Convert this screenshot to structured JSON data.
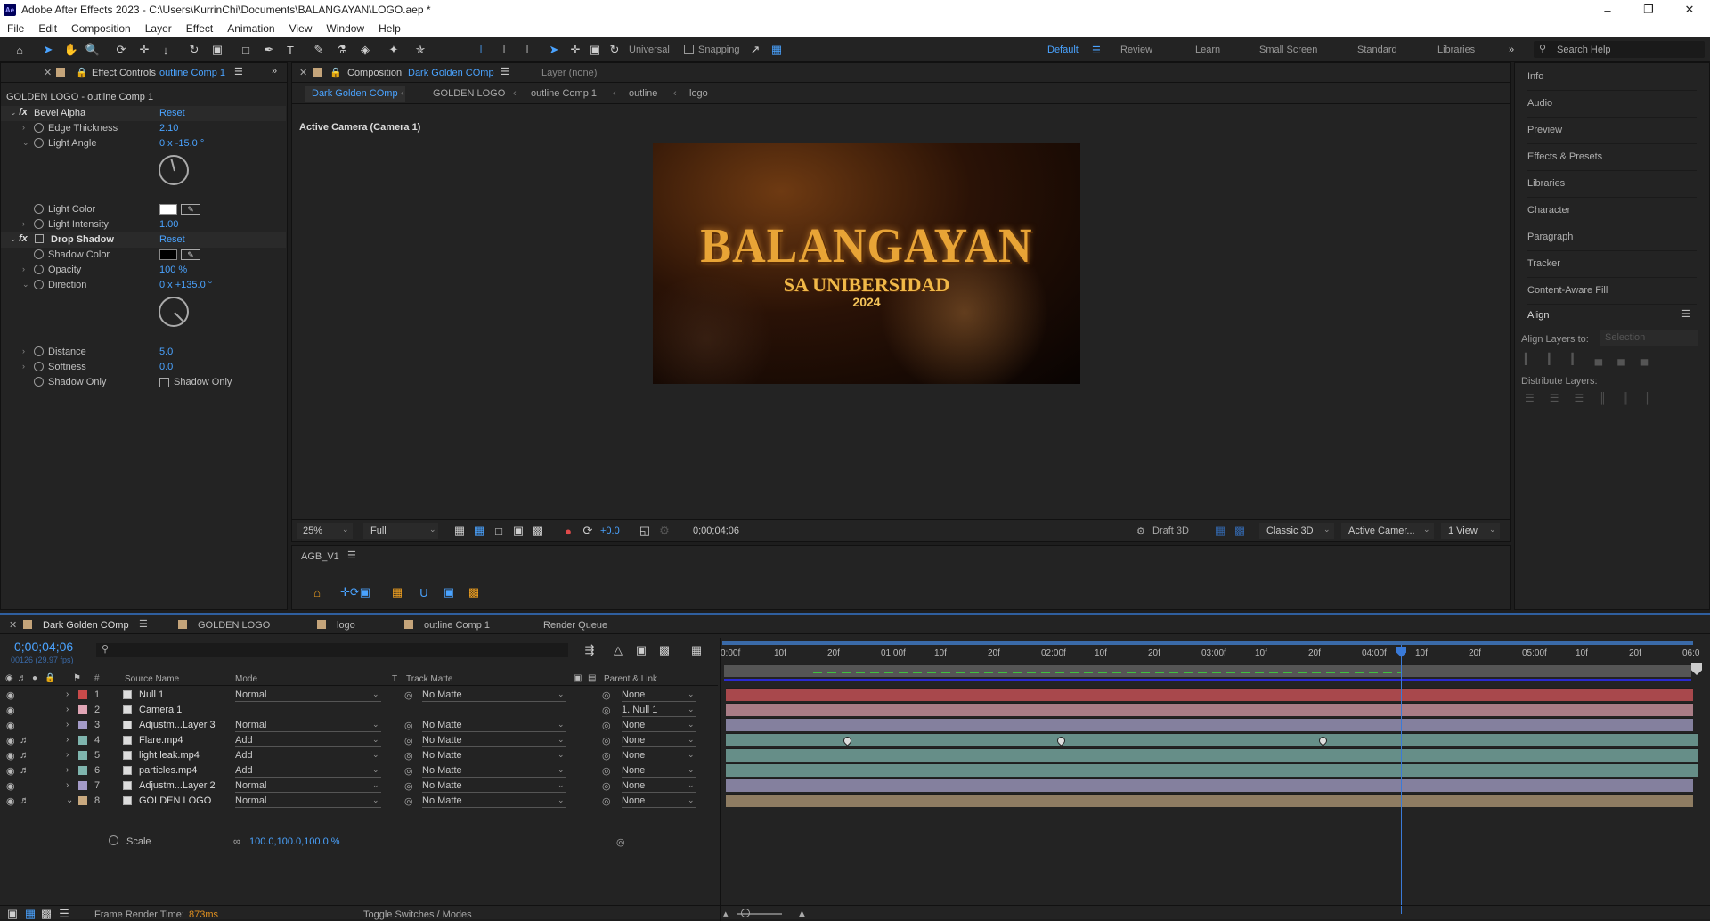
{
  "window": {
    "title": "Adobe After Effects 2023 - C:\\Users\\KurrinChi\\Documents\\BALANGAYAN\\LOGO.aep *",
    "app_icon": "Ae"
  },
  "menu": [
    "File",
    "Edit",
    "Composition",
    "Layer",
    "Effect",
    "Animation",
    "View",
    "Window",
    "Help"
  ],
  "toolbar": {
    "universal": "Universal",
    "snapping": "Snapping",
    "search_help": "Search Help"
  },
  "workspaces": [
    "Default",
    "Review",
    "Learn",
    "Small Screen",
    "Standard",
    "Libraries"
  ],
  "effect_controls": {
    "tab_label": "Effect Controls",
    "tab_target": "outline Comp 1",
    "header": "GOLDEN LOGO - outline Comp 1",
    "bevel_alpha": {
      "name": "Bevel Alpha",
      "reset": "Reset"
    },
    "edge_thickness": {
      "label": "Edge Thickness",
      "value": "2.10"
    },
    "light_angle": {
      "label": "Light Angle",
      "value": "0 x -15.0 °",
      "angle": -15
    },
    "light_color": {
      "label": "Light Color",
      "swatch": "#ffffff"
    },
    "light_intensity": {
      "label": "Light Intensity",
      "value": "1.00"
    },
    "drop_shadow": {
      "name": "Drop Shadow",
      "reset": "Reset"
    },
    "shadow_color": {
      "label": "Shadow Color",
      "swatch": "#000000"
    },
    "opacity": {
      "label": "Opacity",
      "value": "100 %"
    },
    "direction": {
      "label": "Direction",
      "value": "0 x +135.0 °",
      "angle": 135
    },
    "distance": {
      "label": "Distance",
      "value": "5.0"
    },
    "softness": {
      "label": "Softness",
      "value": "0.0"
    },
    "shadow_only": {
      "label": "Shadow Only",
      "checkbox_label": "Shadow Only"
    }
  },
  "composition": {
    "tab_label": "Composition",
    "tab_target": "Dark Golden COmp",
    "layer_tab": "Layer (none)",
    "breadcrumb": [
      "Dark Golden COmp",
      "GOLDEN LOGO",
      "outline Comp 1",
      "outline",
      "logo"
    ],
    "camera_label": "Active Camera (Camera 1)",
    "logo_title": "BALANGAYAN",
    "logo_sub": "SA UNIBERSIDAD",
    "logo_year": "2024"
  },
  "viewer_bar": {
    "zoom": "25%",
    "resolution": "Full",
    "exposure": "+0.0",
    "timecode": "0;00;04;06",
    "draft3d": "Draft 3D",
    "renderer": "Classic 3D",
    "camera": "Active Camer...",
    "views": "1 View"
  },
  "agb": {
    "title": "AGB_V1"
  },
  "side_panels": [
    "Info",
    "Audio",
    "Preview",
    "Effects & Presets",
    "Libraries",
    "Character",
    "Paragraph",
    "Tracker",
    "Content-Aware Fill"
  ],
  "align": {
    "title": "Align",
    "align_to_label": "Align Layers to:",
    "align_to_value": "Selection",
    "distribute": "Distribute Layers:"
  },
  "timeline": {
    "tabs": [
      "Dark Golden COmp",
      "GOLDEN LOGO",
      "logo",
      "outline Comp 1",
      "Render Queue"
    ],
    "timecode": "0;00;04;06",
    "frames": "00126 (29.97 fps)",
    "headers": {
      "source": "Source Name",
      "mode": "Mode",
      "t": "T",
      "track_matte": "Track Matte",
      "parent": "Parent & Link"
    },
    "ruler": [
      "0:00f",
      "10f",
      "20f",
      "01:00f",
      "10f",
      "20f",
      "02:00f",
      "10f",
      "20f",
      "03:00f",
      "10f",
      "20f",
      "04:00f",
      "10f",
      "20f",
      "05:00f",
      "10f",
      "20f",
      "06:0"
    ],
    "layers": [
      {
        "num": "1",
        "name": "Null 1",
        "mode": "Normal",
        "matte": "No Matte",
        "parent": "None",
        "color": "#c94a4a",
        "bar": "#a8484c"
      },
      {
        "num": "2",
        "name": "Camera 1",
        "mode": "",
        "matte": "",
        "parent": "1. Null 1",
        "color": "#e0a5b5",
        "bar": "#a97c86"
      },
      {
        "num": "3",
        "name": "Adjustm...Layer 3",
        "mode": "Normal",
        "matte": "No Matte",
        "parent": "None",
        "color": "#a49bc8",
        "bar": "#84809e"
      },
      {
        "num": "4",
        "name": "Flare.mp4",
        "mode": "Add",
        "matte": "No Matte",
        "parent": "None",
        "color": "#7fb5ae",
        "bar": "#668e88"
      },
      {
        "num": "5",
        "name": "light leak.mp4",
        "mode": "Add",
        "matte": "No Matte",
        "parent": "None",
        "color": "#7fb5ae",
        "bar": "#668e88"
      },
      {
        "num": "6",
        "name": "particles.mp4",
        "mode": "Add",
        "matte": "No Matte",
        "parent": "None",
        "color": "#7fb5ae",
        "bar": "#668e88"
      },
      {
        "num": "7",
        "name": "Adjustm...Layer 2",
        "mode": "Normal",
        "matte": "No Matte",
        "parent": "None",
        "color": "#a49bc8",
        "bar": "#84809e"
      },
      {
        "num": "8",
        "name": "GOLDEN LOGO",
        "mode": "Normal",
        "matte": "No Matte",
        "parent": "None",
        "color": "#c9a97f",
        "bar": "#8e7c62"
      }
    ],
    "scale": {
      "label": "Scale",
      "value": "100.0,100.0,100.0 %"
    },
    "footer": {
      "render_label": "Frame Render Time:",
      "render_value": "873ms",
      "toggle": "Toggle Switches / Modes"
    }
  }
}
